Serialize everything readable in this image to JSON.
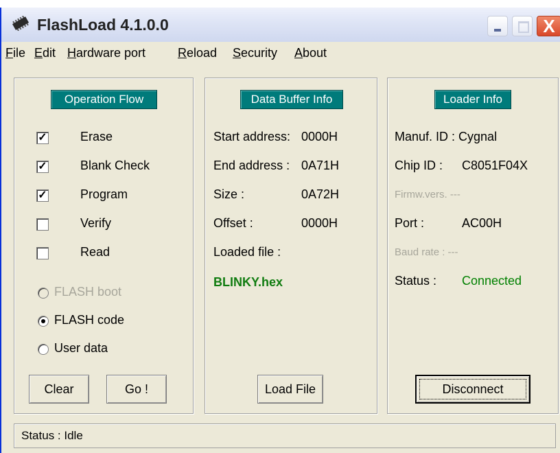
{
  "window": {
    "title": "FlashLoad 4.1.0.0",
    "close_glyph": "X",
    "icons": [
      "chip-icon",
      "minimize-icon",
      "maximize-icon",
      "close-icon"
    ]
  },
  "menu": [
    {
      "label": "File",
      "mnemonic": "F"
    },
    {
      "label": "Edit",
      "mnemonic": "E"
    },
    {
      "label": "Hardware port",
      "mnemonic": "H"
    },
    {
      "label": "Reload",
      "mnemonic": "R"
    },
    {
      "label": "Security",
      "mnemonic": "S"
    },
    {
      "label": "About",
      "mnemonic": "A"
    }
  ],
  "operation_flow": {
    "title": "Operation Flow",
    "steps": [
      {
        "label": "Erase",
        "checked": true
      },
      {
        "label": "Blank Check",
        "checked": true
      },
      {
        "label": "Program",
        "checked": true
      },
      {
        "label": "Verify",
        "checked": false
      },
      {
        "label": "Read",
        "checked": false
      }
    ],
    "memory": [
      {
        "label": "FLASH boot",
        "selected": false,
        "enabled": false
      },
      {
        "label": "FLASH code",
        "selected": true,
        "enabled": true
      },
      {
        "label": "User data",
        "selected": false,
        "enabled": true
      }
    ],
    "clear_label": "Clear",
    "go_label": "Go !"
  },
  "data_buffer": {
    "title": "Data Buffer Info",
    "start_label": "Start address:",
    "start_value": "0000H",
    "end_label": "End address :",
    "end_value": "0A71H",
    "size_label": "Size :",
    "size_value": "0A72H",
    "offset_label": "Offset :",
    "offset_value": "0000H",
    "loaded_label": "Loaded file :",
    "loaded_file": "BLINKY.hex",
    "load_button": "Load File"
  },
  "loader": {
    "title": "Loader Info",
    "manuf": "Manuf. ID : Cygnal",
    "chip_label": "Chip ID :",
    "chip_value": "C8051F04X",
    "firmware": "Firmw.vers. ---",
    "port_label": "Port :",
    "port_value": "AC00H",
    "baud": "Baud rate : ---",
    "status_label": "Status :",
    "status_value": "Connected",
    "disconnect_button": "Disconnect"
  },
  "statusbar": "Status : Idle",
  "colors": {
    "accent_teal": "#007b7b",
    "connected_green": "#008000",
    "loaded_file_green": "#107c10",
    "face": "#ece9d8"
  }
}
